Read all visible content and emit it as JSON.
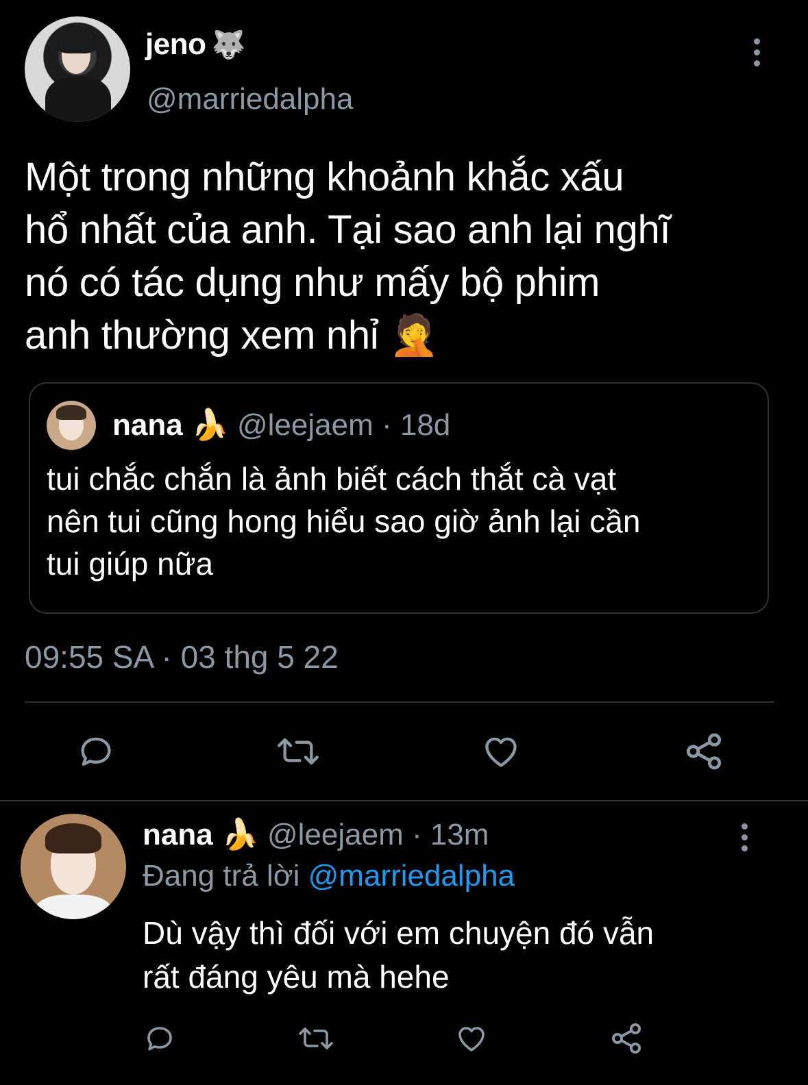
{
  "main_tweet": {
    "display_name": "jeno",
    "name_emoji": "🐺",
    "handle": "@marriedalpha",
    "text": "Một trong những khoảnh khắc xấu\nhổ nhất của anh. Tại sao anh lại nghĩ\nnó có tác dụng như mấy bộ phim\nanh thường xem nhỉ 🤦",
    "timestamp": "09:55 SA · 03 thg 5 22",
    "more_icon": "more-vertical-icon"
  },
  "quoted_tweet": {
    "display_name": "nana",
    "name_emoji": "🍌",
    "handle": "@leejaem",
    "age": "· 18d",
    "text": "tui chắc chắn là ảnh biết cách thắt cà vạt\nnên tui cũng hong hiểu sao giờ ảnh lại cần\ntui giúp nữa"
  },
  "actions": {
    "icons": [
      "reply-icon",
      "retweet-icon",
      "like-icon",
      "share-icon"
    ]
  },
  "reply": {
    "display_name": "nana",
    "name_emoji": "🍌",
    "handle": "@leejaem",
    "age": "· 13m",
    "replying_prefix": "Đang trả lời",
    "replying_mention": "@marriedalpha",
    "text": "Dù vậy thì đối với em chuyện đó vẫn\nrất đáng yêu mà hehe"
  },
  "colors": {
    "background": "#000000",
    "muted": "#8b98a5",
    "link": "#1d9bf0",
    "divider": "#2f3336"
  }
}
